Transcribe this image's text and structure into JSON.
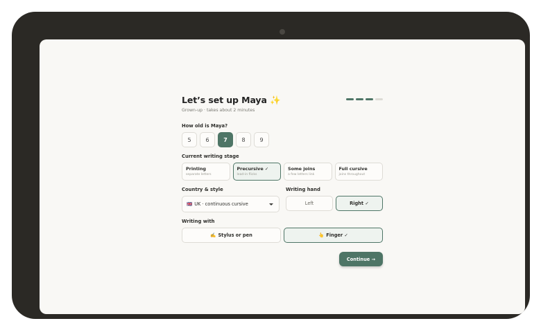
{
  "header": {
    "title": "Let’s set up Maya",
    "title_emoji": "✨",
    "subtitle": "Grown-up · takes about 2 minutes",
    "progress": {
      "total_steps": 4,
      "completed_steps": 3
    }
  },
  "age": {
    "label": "How old is Maya?",
    "options": [
      "5",
      "6",
      "7",
      "8",
      "9"
    ],
    "selected": "7"
  },
  "stage": {
    "label": "Current writing stage",
    "options": [
      {
        "name": "Printing",
        "desc": "separate letters"
      },
      {
        "name": "Precursive ✓",
        "desc": "lead-in flicks"
      },
      {
        "name": "Some joins",
        "desc": "a few letters link"
      },
      {
        "name": "Full cursive",
        "desc": "joins throughout"
      }
    ],
    "selected": "Precursive"
  },
  "country": {
    "label": "Country & style",
    "flag": "🇬🇧",
    "value": "UK · continuous cursive"
  },
  "hand": {
    "label": "Writing hand",
    "options": [
      "Left",
      "Right ✓"
    ],
    "selected": "Right"
  },
  "tool": {
    "label": "Writing with",
    "options": [
      {
        "emoji": "✍️",
        "text": "Stylus or pen"
      },
      {
        "emoji": "👆",
        "text": "Finger ✓"
      }
    ],
    "selected": "Finger"
  },
  "actions": {
    "continue_label": "Continue →"
  },
  "colors": {
    "accent": "#4e7566",
    "accent_soft": "#eef3ef",
    "bezel": "#2b2925",
    "screen_bg": "#f9f8f5"
  }
}
